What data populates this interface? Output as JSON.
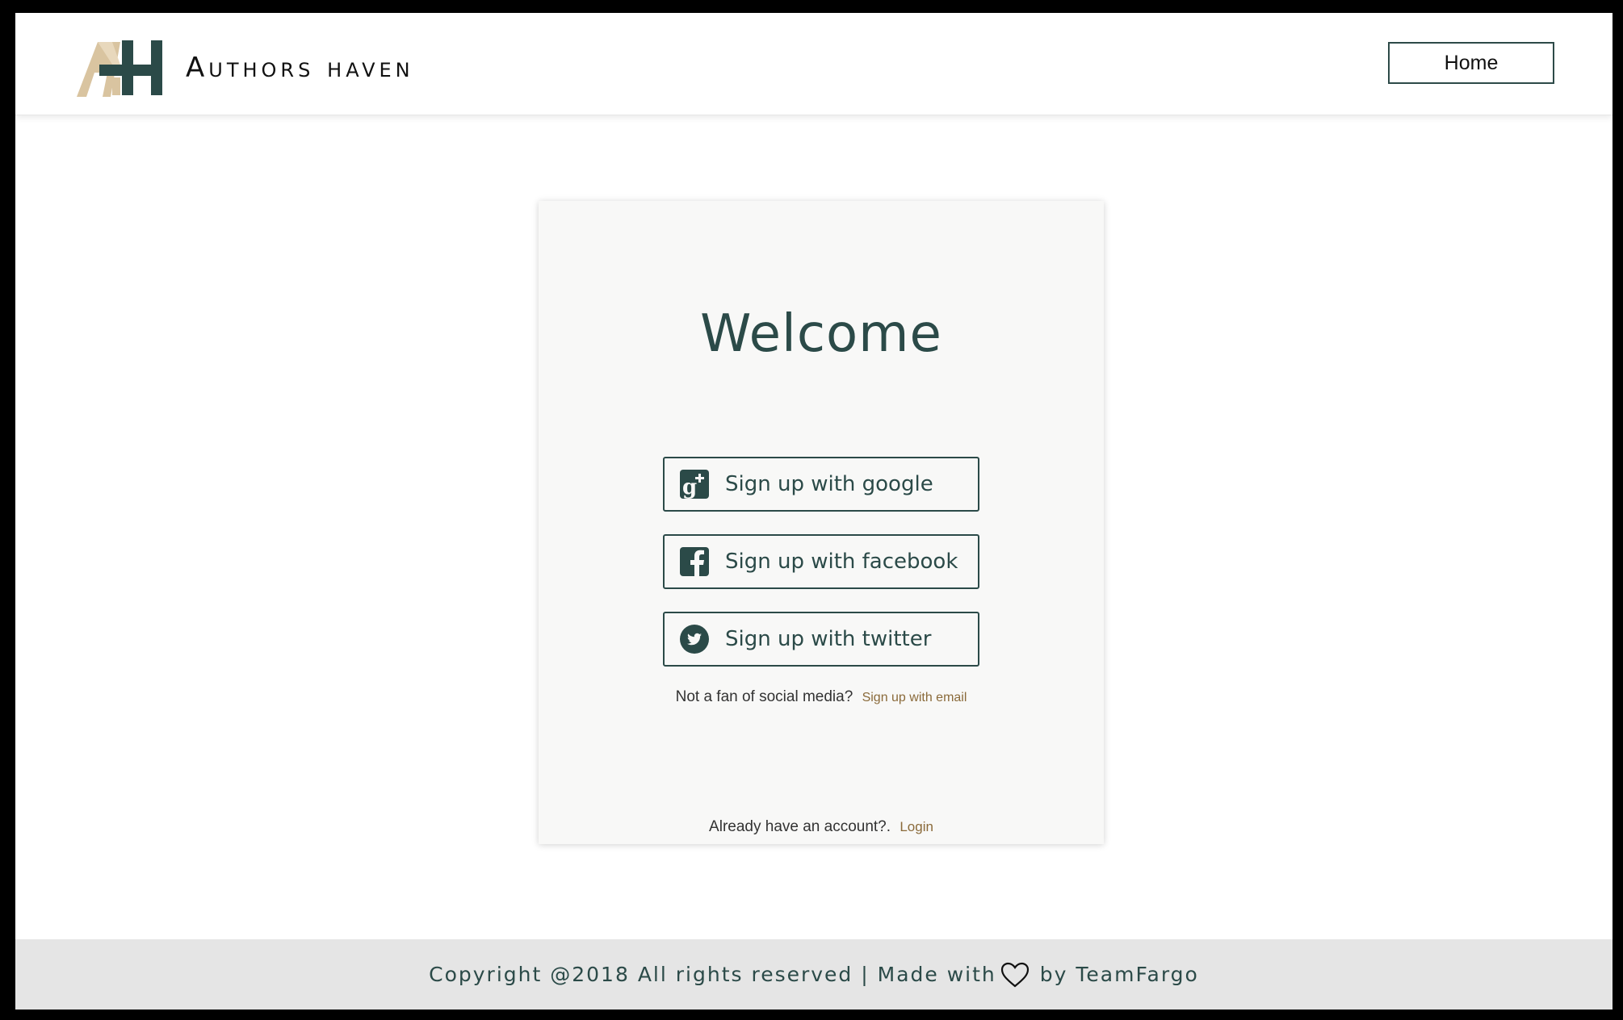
{
  "header": {
    "brand": "Authors haven",
    "home_label": "Home"
  },
  "card": {
    "title": "Welcome",
    "buttons": [
      {
        "label": "Sign up with google",
        "icon": "google-plus-icon"
      },
      {
        "label": "Sign up with facebook",
        "icon": "facebook-icon"
      },
      {
        "label": "Sign up with twitter",
        "icon": "twitter-icon"
      }
    ],
    "email_prompt": "Not a fan of social media?",
    "email_link": "Sign up with email",
    "login_prompt": "Already have an account?.",
    "login_link": "Login"
  },
  "footer": {
    "text_before": "Copyright @2018 All rights reserved | Made with",
    "text_after": "by TeamFargo",
    "icon": "heart-icon"
  },
  "colors": {
    "accent": "#2b4a48",
    "link": "#8a6a3a",
    "logo_tan": "#d9c4a0",
    "footer_bg": "#e5e5e5"
  }
}
